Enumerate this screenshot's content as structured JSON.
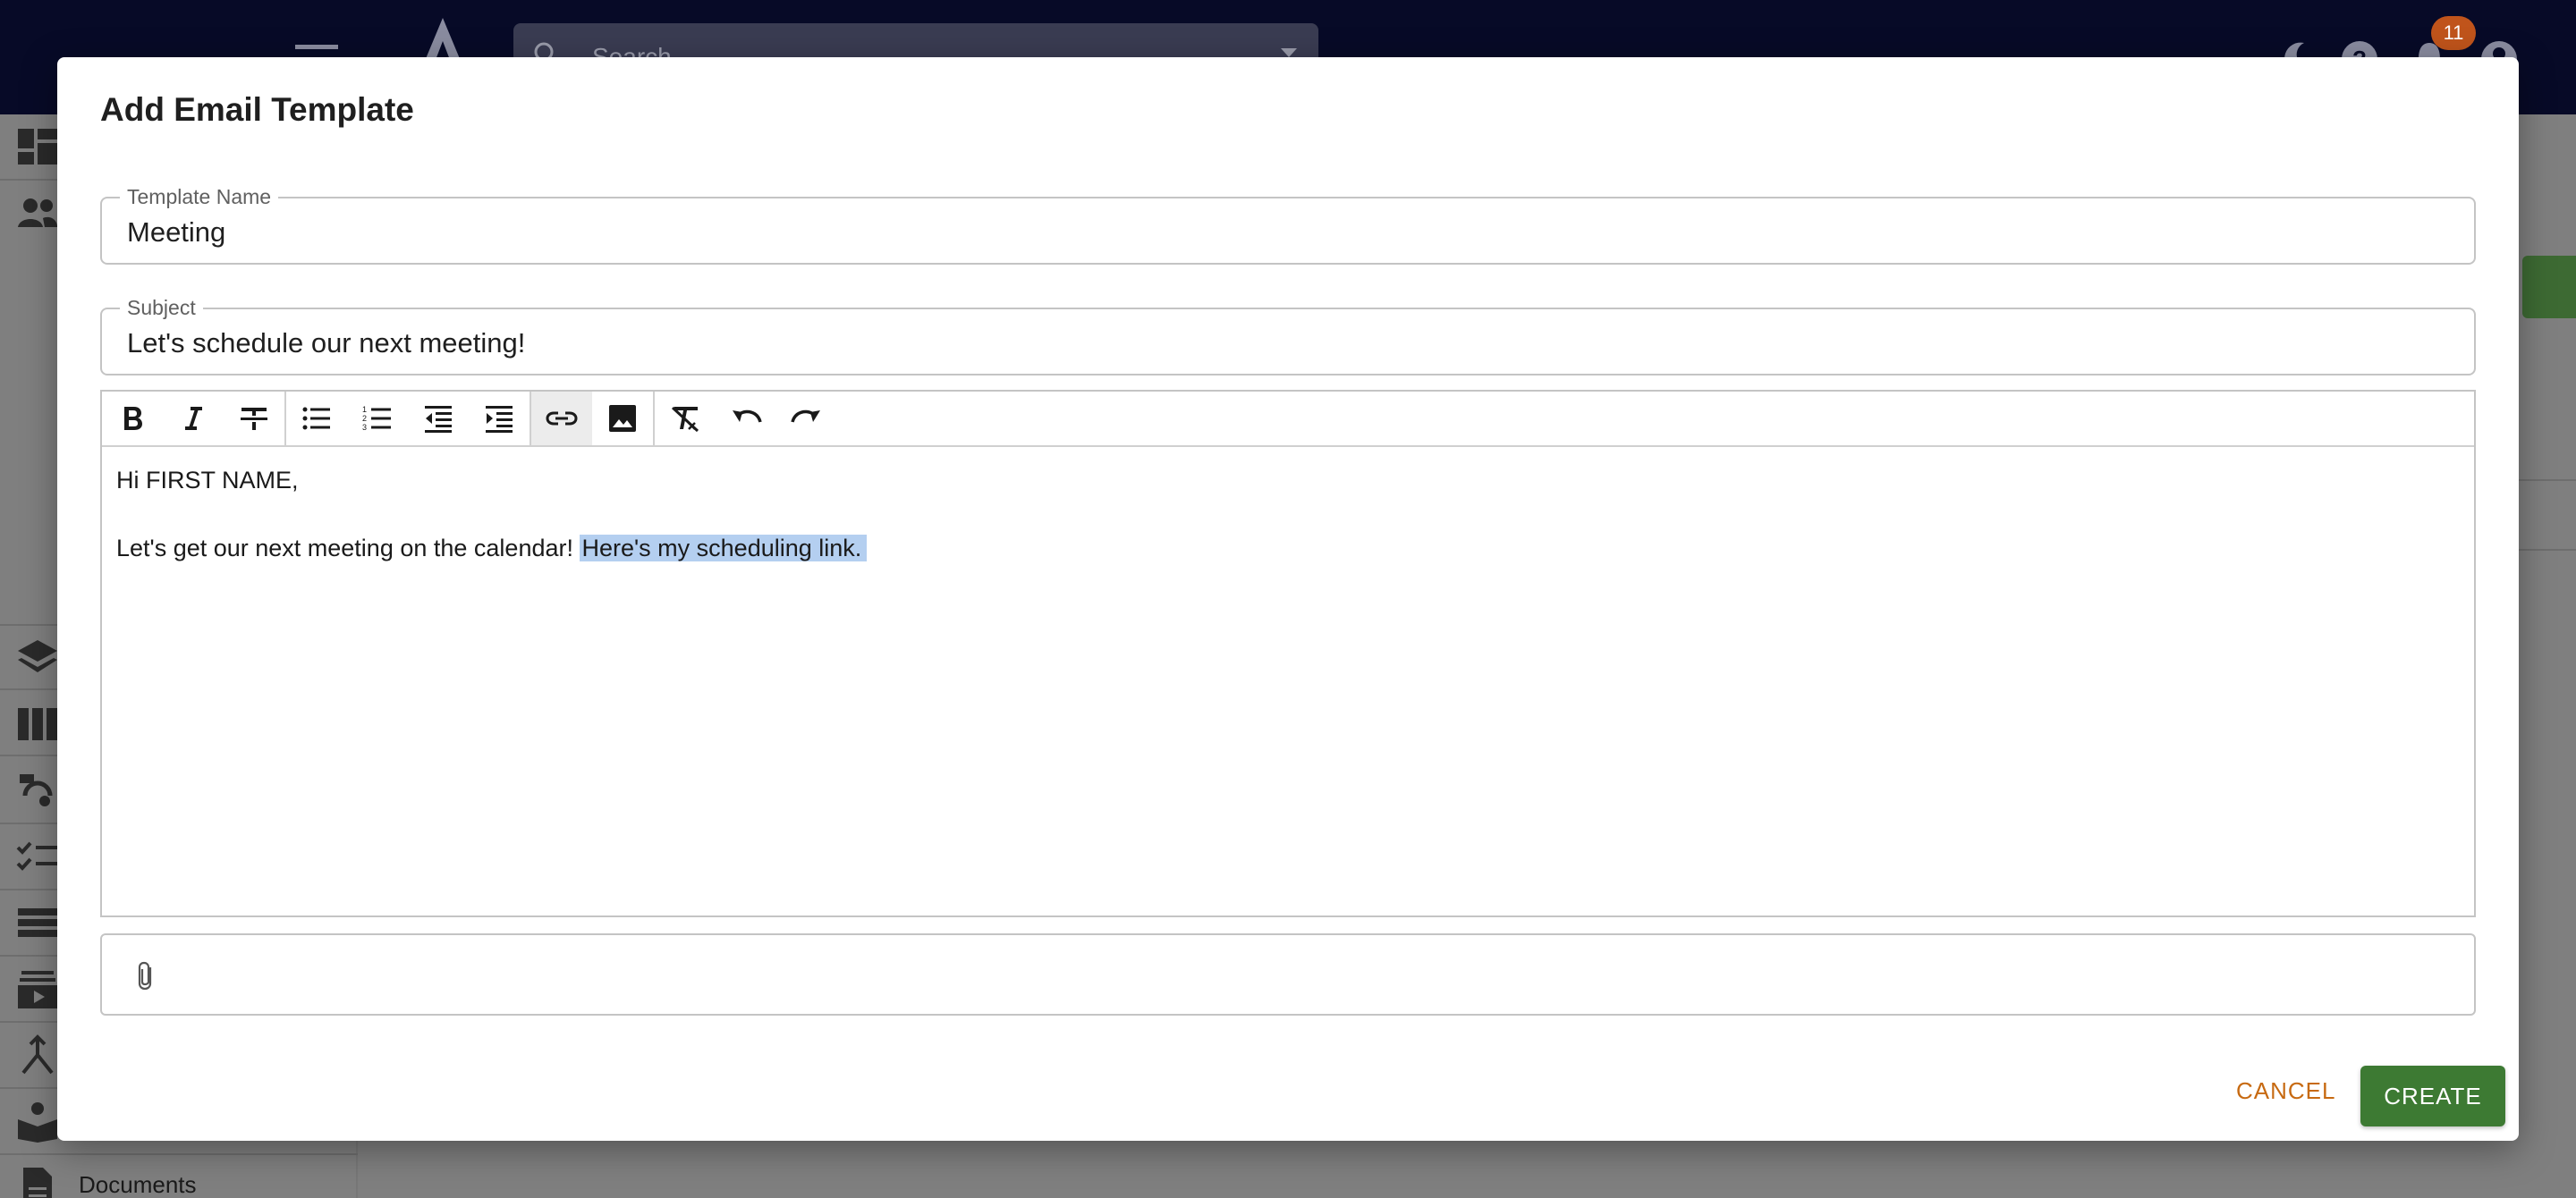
{
  "app": {
    "search_placeholder": "Search",
    "notification_count": "11",
    "sidebar_documents": "Documents"
  },
  "dialog": {
    "title": "Add Email Template",
    "template_name": {
      "label": "Template Name",
      "value": "Meeting"
    },
    "subject": {
      "label": "Subject",
      "value": "Let's schedule our next meeting!"
    },
    "toolbar": [
      "bold-icon",
      "italic-icon",
      "strikethrough-icon",
      "bulleted-list-icon",
      "numbered-list-icon",
      "outdent-icon",
      "indent-icon",
      "link-icon",
      "image-icon",
      "clear-format-icon",
      "undo-icon",
      "redo-icon"
    ],
    "body": {
      "greeting": "Hi FIRST NAME,",
      "line_prefix": "Let's get our next meeting on the calendar! ",
      "line_selected": "Here's my scheduling link."
    },
    "cancel_label": "CANCEL",
    "create_label": "CREATE"
  },
  "colors": {
    "topbar": "#070a27",
    "primary_button": "#3d7a33",
    "cancel_text": "#c76a12",
    "badge": "#c0541b",
    "selection": "#b4cff0"
  }
}
